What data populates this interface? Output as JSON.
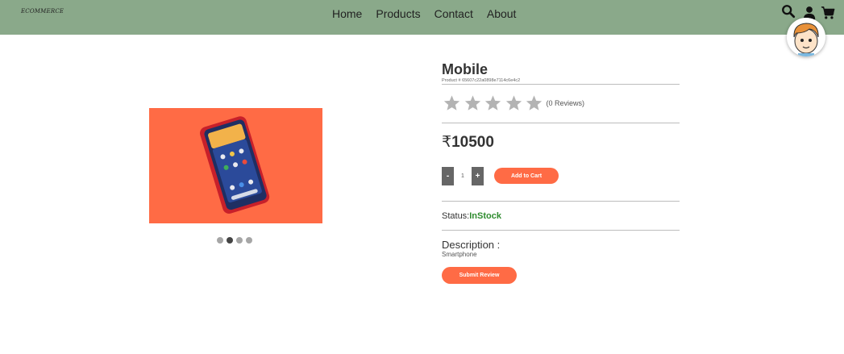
{
  "header": {
    "logo_text": "ECOMMERCE",
    "nav": [
      "Home",
      "Products",
      "Contact",
      "About"
    ],
    "icons": [
      "search-icon",
      "user-icon",
      "cart-icon"
    ],
    "background_color": "#8aa98a"
  },
  "carousel": {
    "slide_count": 4,
    "active_index": 1,
    "image_description_icon": "phone-image"
  },
  "product": {
    "name": "Mobile",
    "id_label": "Product # 65607c22a0898e7114c6e4c2",
    "rating": 0,
    "max_rating": 5,
    "reviews_text": "(0 Reviews)",
    "currency_symbol": "₹",
    "price": "10500",
    "quantity": "1",
    "minus_label": "-",
    "plus_label": "+",
    "add_to_cart_label": "Add to Cart",
    "status_label": "Status:",
    "status_value": "InStock",
    "description_label": "Description :",
    "description_text": "Smartphone",
    "submit_review_label": "Submit Review"
  },
  "colors": {
    "accent": "#ff6b45",
    "in_stock": "#2e8b2e",
    "star_empty": "#b3b3b3"
  }
}
